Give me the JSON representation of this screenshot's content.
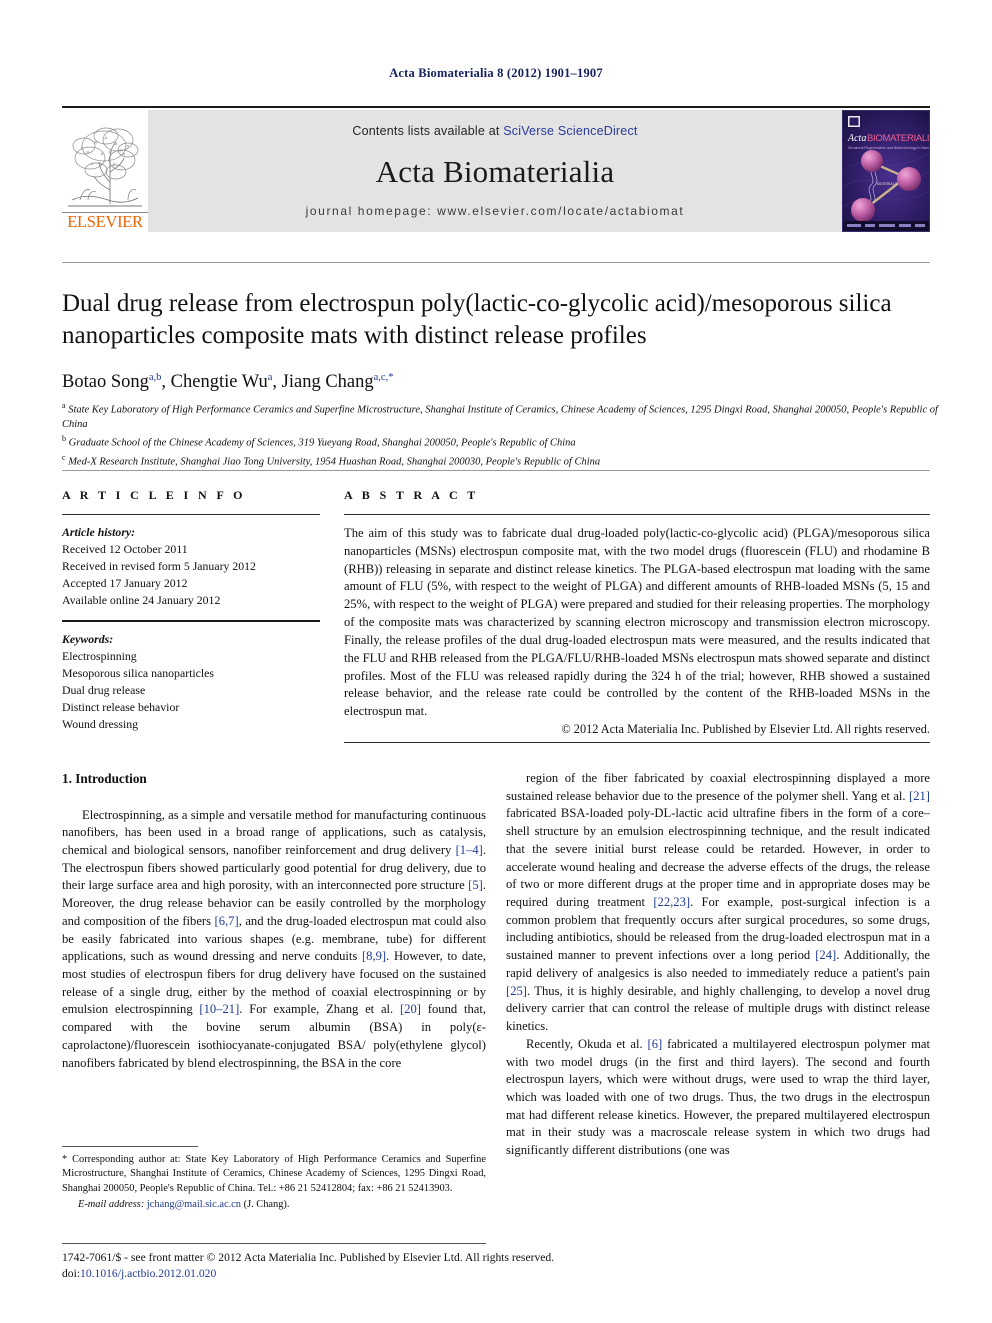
{
  "running_head": "Acta Biomaterialia 8 (2012) 1901–1907",
  "masthead": {
    "publisher_logo_text": "ELSEVIER",
    "contents_prefix": "Contents lists available at",
    "contents_link": "SciVerse ScienceDirect",
    "journal_name": "Acta Biomaterialia",
    "homepage_label": "journal homepage: www.elsevier.com/locate/actabiomat",
    "cover_title_italic": "Acta",
    "cover_title_rest": "BIOMATERIALIA",
    "cover_subtitle": "Structural Regeneration and Biotechnology in Biomaterials"
  },
  "article": {
    "title": "Dual drug release from electrospun poly(lactic-co-glycolic acid)/mesoporous silica nanoparticles composite mats with distinct release profiles",
    "authors": [
      {
        "name": "Botao Song",
        "sup": "a,b",
        "sep": ", "
      },
      {
        "name": "Chengtie Wu",
        "sup": "a",
        "sep": ", "
      },
      {
        "name": "Jiang Chang",
        "sup": "a,c,",
        "sup_star": "*",
        "sep": ""
      }
    ],
    "affiliations": [
      {
        "label": "a",
        "text": "State Key Laboratory of High Performance Ceramics and Superfine Microstructure, Shanghai Institute of Ceramics, Chinese Academy of Sciences, 1295 Dingxi Road, Shanghai 200050, People's Republic of China"
      },
      {
        "label": "b",
        "text": "Graduate School of the Chinese Academy of Sciences, 319 Yueyang Road, Shanghai 200050, People's Republic of China"
      },
      {
        "label": "c",
        "text": "Med-X Research Institute, Shanghai Jiao Tong University, 1954 Huashan Road, Shanghai 200030, People's Republic of China"
      }
    ]
  },
  "article_info": {
    "heading": "A R T I C L E   I N F O",
    "history_label": "Article history:",
    "history": [
      "Received 12 October 2011",
      "Received in revised form 5 January 2012",
      "Accepted 17 January 2012",
      "Available online 24 January 2012"
    ],
    "keywords_label": "Keywords:",
    "keywords": [
      "Electrospinning",
      "Mesoporous silica nanoparticles",
      "Dual drug release",
      "Distinct release behavior",
      "Wound dressing"
    ]
  },
  "abstract": {
    "heading": "A B S T R A C T",
    "text": "The aim of this study was to fabricate dual drug-loaded poly(lactic-co-glycolic acid) (PLGA)/mesoporous silica nanoparticles (MSNs) electrospun composite mat, with the two model drugs (fluorescein (FLU) and rhodamine B (RHB)) releasing in separate and distinct release kinetics. The PLGA-based electrospun mat loading with the same amount of FLU (5%, with respect to the weight of PLGA) and different amounts of RHB-loaded MSNs (5, 15 and 25%, with respect to the weight of PLGA) were prepared and studied for their releasing properties. The morphology of the composite mats was characterized by scanning electron microscopy and transmission electron microscopy. Finally, the release profiles of the dual drug-loaded electrospun mats were measured, and the results indicated that the FLU and RHB released from the PLGA/FLU/RHB-loaded MSNs electrospun mats showed separate and distinct profiles. Most of the FLU was released rapidly during the 324 h of the trial; however, RHB showed a sustained release behavior, and the release rate could be controlled by the content of the RHB-loaded MSNs in the electrospun mat.",
    "copyright": "© 2012 Acta Materialia Inc. Published by Elsevier Ltd. All rights reserved."
  },
  "body": {
    "section_heading": "1. Introduction",
    "left_paragraphs": [
      "Electrospinning, as a simple and versatile method for manufacturing continuous nanofibers, has been used in a broad range of applications, such as catalysis, chemical and biological sensors, nanofiber reinforcement and drug delivery [1–4]. The electrospun fibers showed particularly good potential for drug delivery, due to their large surface area and high porosity, with an interconnected pore structure [5]. Moreover, the drug release behavior can be easily controlled by the morphology and composition of the fibers [6,7], and the drug-loaded electrospun mat could also be easily fabricated into various shapes (e.g. membrane, tube) for different applications, such as wound dressing and nerve conduits [8,9]. However, to date, most studies of electrospun fibers for drug delivery have focused on the sustained release of a single drug, either by the method of coaxial electrospinning or by emulsion electrospinning [10–21]. For example, Zhang et al. [20] found that, compared with the bovine serum albumin (BSA) in poly(ε-caprolactone)/fluorescein isothiocyanate-conjugated BSA/ poly(ethylene glycol) nanofibers fabricated by blend electrospinning, the BSA in the core"
    ],
    "right_paragraphs": [
      "region of the fiber fabricated by coaxial electrospinning displayed a more sustained release behavior due to the presence of the polymer shell. Yang et al. [21] fabricated BSA-loaded poly-DL-lactic acid ultrafine fibers in the form of a core–shell structure by an emulsion electrospinning technique, and the result indicated that the severe initial burst release could be retarded. However, in order to accelerate wound healing and decrease the adverse effects of the drugs, the release of two or more different drugs at the proper time and in appropriate doses may be required during treatment [22,23]. For example, post-surgical infection is a common problem that frequently occurs after surgical procedures, so some drugs, including antibiotics, should be released from the drug-loaded electrospun mat in a sustained manner to prevent infections over a long period [24]. Additionally, the rapid delivery of analgesics is also needed to immediately reduce a patient's pain [25]. Thus, it is highly desirable, and highly challenging, to develop a novel drug delivery carrier that can control the release of multiple drugs with distinct release kinetics.",
      "Recently, Okuda et al. [6] fabricated a multilayered electrospun polymer mat with two model drugs (in the first and third layers). The second and fourth electrospun layers, which were without drugs, were used to wrap the third layer, which was loaded with one of two drugs. Thus, the two drugs in the electrospun mat had different release kinetics. However, the prepared multilayered electrospun mat in their study was a macroscale release system in which two drugs had significantly different distributions (one was"
    ]
  },
  "footnote": {
    "corresponding": "* Corresponding author at: State Key Laboratory of High Performance Ceramics and Superfine Microstructure, Shanghai Institute of Ceramics, Chinese Academy of Sciences, 1295 Dingxi Road, Shanghai 200050, People's Republic of China. Tel.: +86 21 52412804; fax: +86 21 52413903.",
    "email_label": "E-mail address:",
    "email": "jchang@mail.sic.ac.cn",
    "email_suffix": "(J. Chang)."
  },
  "page_footer": {
    "issn_line": "1742-7061/$ - see front matter © 2012 Acta Materialia Inc. Published by Elsevier Ltd. All rights reserved.",
    "doi_prefix": "doi:",
    "doi": "10.1016/j.actbio.2012.01.020"
  },
  "colors": {
    "running_head": "#14215c",
    "link": "#2b3c9b",
    "reference": "#1f3a93",
    "elsevier_orange": "#eb6608",
    "band_gray": "#e3e3e3",
    "cover_purple": "#2a1b5e"
  }
}
